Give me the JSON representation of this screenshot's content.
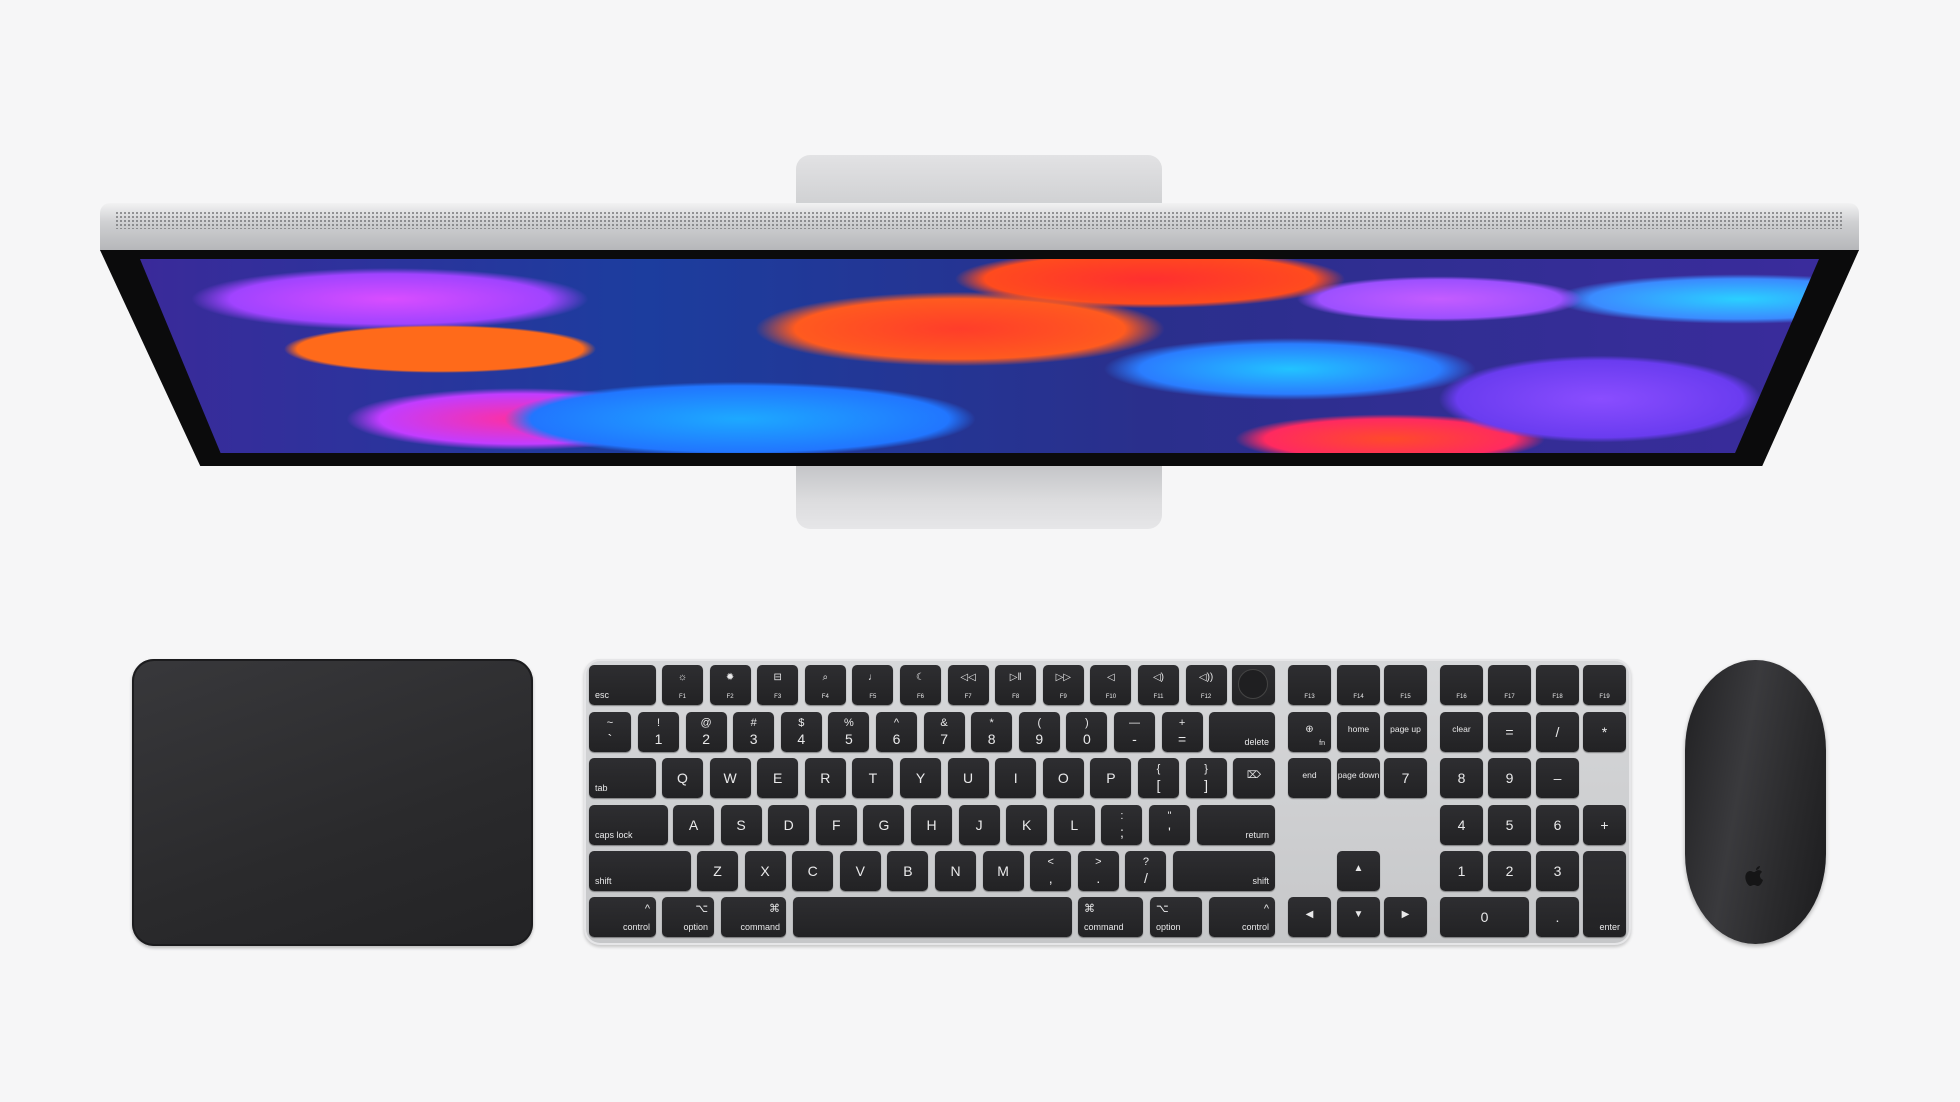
{
  "scene": {
    "background": "#f6f6f7",
    "keyboard_case": "#c9cacc",
    "key_color": "#262628",
    "trackpad_color": "#2c2c2e",
    "mouse_color": "#2a2a2c"
  },
  "keyboard": {
    "rows": [
      [
        {
          "label": "esc"
        },
        {
          "label": "F1",
          "glyph": "☼",
          "icon": "brightness-down-icon"
        },
        {
          "label": "F2",
          "glyph": "✹",
          "icon": "brightness-up-icon"
        },
        {
          "label": "F3",
          "glyph": "⊟",
          "icon": "mission-control-icon"
        },
        {
          "label": "F4",
          "glyph": "⌕",
          "icon": "search-icon"
        },
        {
          "label": "F5",
          "glyph": "♩",
          "icon": "microphone-icon"
        },
        {
          "label": "F6",
          "glyph": "☾",
          "icon": "moon-icon"
        },
        {
          "label": "F7",
          "glyph": "◁◁",
          "icon": "rewind-icon"
        },
        {
          "label": "F8",
          "glyph": "▷‖",
          "icon": "play-pause-icon"
        },
        {
          "label": "F9",
          "glyph": "▷▷",
          "icon": "fast-forward-icon"
        },
        {
          "label": "F10",
          "glyph": "◁",
          "icon": "mute-icon"
        },
        {
          "label": "F11",
          "glyph": "◁)",
          "icon": "volume-down-icon"
        },
        {
          "label": "F12",
          "glyph": "◁))",
          "icon": "volume-up-icon"
        },
        {
          "icon": "touch-id-icon"
        },
        {
          "label": "F13"
        },
        {
          "label": "F14"
        },
        {
          "label": "F15"
        },
        {
          "label": "F16"
        },
        {
          "label": "F17"
        },
        {
          "label": "F18"
        },
        {
          "label": "F19"
        }
      ],
      [
        {
          "top": "~",
          "bottom": "`"
        },
        {
          "top": "!",
          "bottom": "1"
        },
        {
          "top": "@",
          "bottom": "2"
        },
        {
          "top": "#",
          "bottom": "3"
        },
        {
          "top": "$",
          "bottom": "4"
        },
        {
          "top": "%",
          "bottom": "5"
        },
        {
          "top": "^",
          "bottom": "6"
        },
        {
          "top": "&",
          "bottom": "7"
        },
        {
          "top": "*",
          "bottom": "8"
        },
        {
          "top": "(",
          "bottom": "9"
        },
        {
          "top": ")",
          "bottom": "0"
        },
        {
          "top": "—",
          "bottom": "-"
        },
        {
          "top": "+",
          "bottom": "="
        },
        {
          "label": "delete"
        },
        {
          "glyph": "⊕",
          "label": "fn",
          "icon": "globe-icon"
        },
        {
          "label": "home"
        },
        {
          "label": "page up"
        },
        {
          "label": "clear"
        },
        {
          "label": "="
        },
        {
          "label": "/"
        },
        {
          "label": "*"
        }
      ],
      [
        {
          "label": "tab"
        },
        {
          "label": "Q"
        },
        {
          "label": "W"
        },
        {
          "label": "E"
        },
        {
          "label": "R"
        },
        {
          "label": "T"
        },
        {
          "label": "Y"
        },
        {
          "label": "U"
        },
        {
          "label": "I"
        },
        {
          "label": "O"
        },
        {
          "label": "P"
        },
        {
          "top": "{",
          "bottom": "["
        },
        {
          "top": "}",
          "bottom": "]"
        },
        {
          "top": "|",
          "bottom": "\\"
        },
        {
          "glyph": "⌦",
          "icon": "forward-delete-icon"
        },
        {
          "label": "end"
        },
        {
          "label": "page down"
        },
        {
          "label": "7"
        },
        {
          "label": "8"
        },
        {
          "label": "9"
        },
        {
          "label": "–"
        }
      ],
      [
        {
          "label": "caps lock"
        },
        {
          "label": "A"
        },
        {
          "label": "S"
        },
        {
          "label": "D"
        },
        {
          "label": "F"
        },
        {
          "label": "G"
        },
        {
          "label": "H"
        },
        {
          "label": "J"
        },
        {
          "label": "K"
        },
        {
          "label": "L"
        },
        {
          "top": ":",
          "bottom": ";"
        },
        {
          "top": "\"",
          "bottom": "'"
        },
        {
          "label": "return"
        },
        {
          "label": "4"
        },
        {
          "label": "5"
        },
        {
          "label": "6"
        },
        {
          "label": "+"
        }
      ],
      [
        {
          "label": "shift"
        },
        {
          "label": "Z"
        },
        {
          "label": "X"
        },
        {
          "label": "C"
        },
        {
          "label": "V"
        },
        {
          "label": "B"
        },
        {
          "label": "N"
        },
        {
          "label": "M"
        },
        {
          "top": "<",
          "bottom": ","
        },
        {
          "top": ">",
          "bottom": "."
        },
        {
          "top": "?",
          "bottom": "/"
        },
        {
          "label": "shift"
        },
        {
          "glyph": "▲",
          "icon": "arrow-up-icon"
        },
        {
          "label": "1"
        },
        {
          "label": "2"
        },
        {
          "label": "3"
        },
        {
          "label": "enter"
        }
      ],
      [
        {
          "symbol": "^",
          "label": "control"
        },
        {
          "symbol": "⌥",
          "label": "option"
        },
        {
          "symbol": "⌘",
          "label": "command"
        },
        {
          "label": ""
        },
        {
          "symbol": "⌘",
          "label": "command"
        },
        {
          "symbol": "⌥",
          "label": "option"
        },
        {
          "symbol": "^",
          "label": "control"
        },
        {
          "glyph": "◀",
          "icon": "arrow-left-icon"
        },
        {
          "glyph": "▼",
          "icon": "arrow-down-icon"
        },
        {
          "glyph": "▶",
          "icon": "arrow-right-icon"
        },
        {
          "label": "0"
        },
        {
          "label": "."
        }
      ]
    ]
  }
}
